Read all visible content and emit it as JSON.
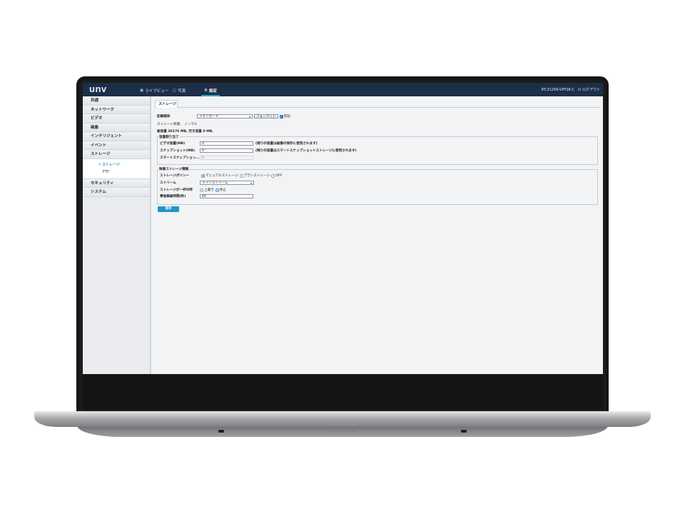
{
  "topbar": {
    "logo": "unv",
    "nav": [
      {
        "icon": "live-view-icon",
        "glyph": "▣",
        "label": "ライブビュー"
      },
      {
        "icon": "photo-icon",
        "glyph": "◱",
        "label": "写真"
      },
      {
        "icon": "settings-icon",
        "glyph": "⚙",
        "label": "設定"
      }
    ],
    "model": "IPC3125R-VPF28-C",
    "logout_icon": "⏻",
    "logout": "ログアウト"
  },
  "sidebar": {
    "items": [
      "共通",
      "ネットワーク",
      "ビデオ",
      "画像",
      "インテリジェント",
      "イベント",
      "ストレージ"
    ],
    "sub_items": [
      "ストレージ",
      "FTP"
    ],
    "bottom_items": [
      "セキュリティ",
      "システム"
    ]
  },
  "main": {
    "tab": "ストレージ",
    "media_label": "記録媒体",
    "media_value": "メモリカード",
    "format_button": "フォーマット",
    "enable_label": "有効",
    "status_text": "ストレージ状態:　ノーマル",
    "capacity_text": "総容量 30176 MB, 空き容量 0 MB.",
    "alloc": {
      "title": "容量割り当て",
      "rows": [
        {
          "label": "ビデオ容量(MB)",
          "value": "0",
          "hint": "(残りの容量は画像の保存に使用されます)"
        },
        {
          "label": "スナップショット(MB)",
          "value": "0",
          "hint": "(残りの容量はスマートスナップショットストレージに使用されます)"
        },
        {
          "label": "スマートスナップショッ...",
          "value": "0",
          "hint": ""
        }
      ]
    },
    "video_storage": {
      "title": "映像ストレージ情報",
      "policy_label": "ストレージポリシー",
      "policy_options": [
        "マニュアルストレージ",
        "プランストレージ",
        "OFF"
      ],
      "policy_selected": 0,
      "stream_label": "ストリーム",
      "stream_value": "メインストリーム",
      "full_label": "ストレージが一杯の時",
      "full_options": [
        "上書き",
        "停止"
      ],
      "full_selected": 1,
      "post_label": "事後録画時間(秒)",
      "post_value": "60"
    },
    "save_button": "保存"
  }
}
